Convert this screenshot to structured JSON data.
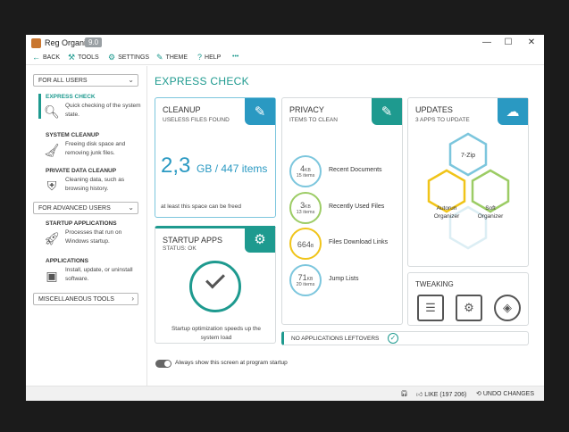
{
  "window": {
    "title": "Reg Organizer",
    "version": "9.0",
    "controls": {
      "minimize": "—",
      "maximize": "☐",
      "close": "✕"
    }
  },
  "menu": {
    "back": "BACK",
    "tools": "TOOLS",
    "settings": "SETTINGS",
    "theme": "THEME",
    "help": "HELP",
    "more": "•••"
  },
  "sidebar": {
    "group_all": "FOR ALL USERS",
    "group_advanced": "FOR ADVANCED USERS",
    "group_misc": "MISCELLANEOUS TOOLS",
    "items": [
      {
        "title": "EXPRESS CHECK",
        "desc": "Quick checking of the system state."
      },
      {
        "title": "SYSTEM CLEANUP",
        "desc": "Freeing disk space and removing junk files."
      },
      {
        "title": "PRIVATE DATA CLEANUP",
        "desc": "Cleaning data, such as browsing history."
      },
      {
        "title": "STARTUP APPLICATIONS",
        "desc": "Processes that run on Windows startup."
      },
      {
        "title": "APPLICATIONS",
        "desc": "Install, update, or uninstall software."
      }
    ]
  },
  "main": {
    "title": "EXPRESS CHECK",
    "cleanup": {
      "title": "CLEANUP",
      "subtitle": "USELESS FILES FOUND",
      "size_value": "2,3",
      "size_unit": "GB / 447 items",
      "note": "at least this space can be freed"
    },
    "startup": {
      "title": "STARTUP APPS",
      "status": "STATUS: OK",
      "note": "Startup optimization speeds up the system load"
    },
    "privacy": {
      "title": "PRIVACY",
      "subtitle": "ITEMS TO CLEAN",
      "rows": [
        {
          "value": "4",
          "unit": "KB",
          "count": "15 items",
          "label": "Recent Documents",
          "color": "#7cc6dd"
        },
        {
          "value": "3",
          "unit": "KB",
          "count": "13 items",
          "label": "Recently Used Files",
          "color": "#9ccc65"
        },
        {
          "value": "664",
          "unit": "B",
          "count": "",
          "label": "Files Download Links",
          "color": "#f0c419"
        },
        {
          "value": "71",
          "unit": "KB",
          "count": "20 items",
          "label": "Jump Lists",
          "color": "#7cc6dd"
        }
      ]
    },
    "updates": {
      "title": "UPDATES",
      "subtitle": "3 APPS TO UPDATE",
      "apps": [
        "7-Zip",
        "Autorun Organizer",
        "Soft Organizer"
      ]
    },
    "tweaking": {
      "title": "TWEAKING"
    },
    "leftovers": "NO APPLICATIONS LEFTOVERS",
    "always_show": "Always show this screen at program startup"
  },
  "statusbar": {
    "like": "LIKE (197 206)",
    "undo": "UNDO CHANGES"
  },
  "colors": {
    "accent_teal": "#1e9a8f",
    "accent_blue": "#2a99c2",
    "green": "#9ccc65",
    "yellow": "#f0c419",
    "light_blue": "#7cc6dd"
  }
}
